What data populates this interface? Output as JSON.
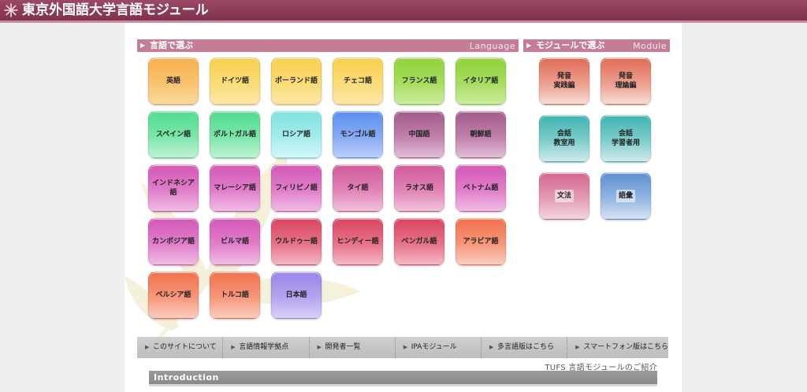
{
  "header": {
    "title": "東京外国語大学言語モジュール"
  },
  "language_section": {
    "title": "言語で選ぶ",
    "title_en": "Language"
  },
  "module_section": {
    "title": "モジュールで選ぶ",
    "title_en": "Module"
  },
  "languages": [
    "英語",
    "ドイツ語",
    "ポーランド語",
    "チェコ語",
    "フランス語",
    "イタリア語",
    "スペイン語",
    "ポルトガル語",
    "ロシア語",
    "モンゴル語",
    "中国語",
    "朝鮮語",
    "インドネシア語",
    "マレーシア語",
    "フィリピノ語",
    "タイ語",
    "ラオス語",
    "ベトナム語",
    "カンボジア語",
    "ビルマ語",
    "ウルドゥー語",
    "ヒンディー語",
    "ベンガル語",
    "アラビア語",
    "ペルシア語",
    "トルコ語",
    "日本語"
  ],
  "modules": [
    "発音\n実践編",
    "発音\n理論編",
    "会話\n教室用",
    "会話\n学習者用",
    "文法",
    "語彙"
  ],
  "nav": [
    "このサイトについて",
    "言語情報学拠点",
    "開発者一覧",
    "IPAモジュール",
    "多言語版はこちら",
    "スマートフォン版はこちら"
  ],
  "intro": {
    "caption": "TUFS 言語モジュールのご紹介",
    "title": "Introduction"
  },
  "colors": {
    "header": "#8a3a55",
    "section_header": "#c47d94",
    "nav_bar": "#c6c6c6",
    "intro_bar": "#8f8f8f"
  }
}
